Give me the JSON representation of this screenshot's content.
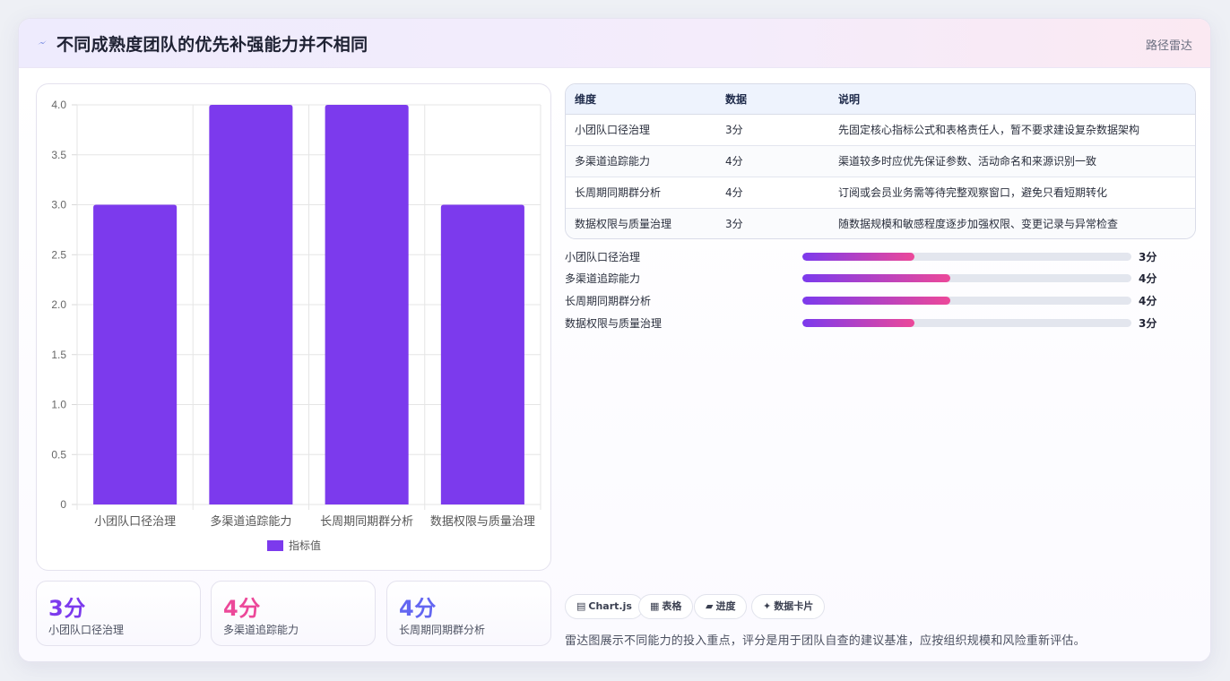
{
  "header": {
    "title": "不同成熟度团队的优先补强能力并不相同",
    "tag": "路径雷达",
    "icon": "lightning-icon"
  },
  "chart_data": {
    "type": "bar",
    "categories": [
      "小团队口径治理",
      "多渠道追踪能力",
      "长周期同期群分析",
      "数据权限与质量治理"
    ],
    "series": [
      {
        "name": "指标值",
        "values": [
          3,
          4,
          4,
          3
        ],
        "color": "#7c3aed"
      }
    ],
    "ylim": [
      0,
      4
    ],
    "yticks": [
      "4.0",
      "3.5",
      "3.0",
      "2.5",
      "2.0",
      "1.5",
      "1.0",
      "0.5",
      "0"
    ],
    "grid": true,
    "legend": "bottom"
  },
  "stats": [
    {
      "value": "3分",
      "label": "小团队口径治理",
      "color": "#7c3aed"
    },
    {
      "value": "4分",
      "label": "多渠道追踪能力",
      "color": "#ec4899"
    },
    {
      "value": "4分",
      "label": "长周期同期群分析",
      "color": "#6366f1"
    }
  ],
  "table": {
    "headers": [
      "维度",
      "数据",
      "说明"
    ],
    "rows": [
      [
        "小团队口径治理",
        "3分",
        "先固定核心指标公式和表格责任人，暂不要求建设复杂数据架构"
      ],
      [
        "多渠道追踪能力",
        "4分",
        "渠道较多时应优先保证参数、活动命名和来源识别一致"
      ],
      [
        "长周期同期群分析",
        "4分",
        "订阅或会员业务需等待完整观察窗口，避免只看短期转化"
      ],
      [
        "数据权限与质量治理",
        "3分",
        "随数据规模和敏感程度逐步加强权限、变更记录与异常检查"
      ]
    ]
  },
  "progress": [
    {
      "label": "小团队口径治理",
      "value": "3分",
      "fraction": 0.34
    },
    {
      "label": "多渠道追踪能力",
      "value": "4分",
      "fraction": 0.45
    },
    {
      "label": "长周期同期群分析",
      "value": "4分",
      "fraction": 0.45
    },
    {
      "label": "数据权限与质量治理",
      "value": "3分",
      "fraction": 0.34
    }
  ],
  "chips": [
    {
      "icon": "▤",
      "label": "Chart.js"
    },
    {
      "icon": "▦",
      "label": "表格"
    },
    {
      "icon": "▰",
      "label": "进度"
    },
    {
      "icon": "✦",
      "label": "数据卡片"
    }
  ],
  "footnote": "雷达图展示不同能力的投入重点，评分是用于团队自查的建议基准，应按组织规模和风险重新评估。",
  "colors": {
    "accent": "#7c3aed",
    "pink": "#ec4899",
    "indigo": "#6366f1"
  }
}
